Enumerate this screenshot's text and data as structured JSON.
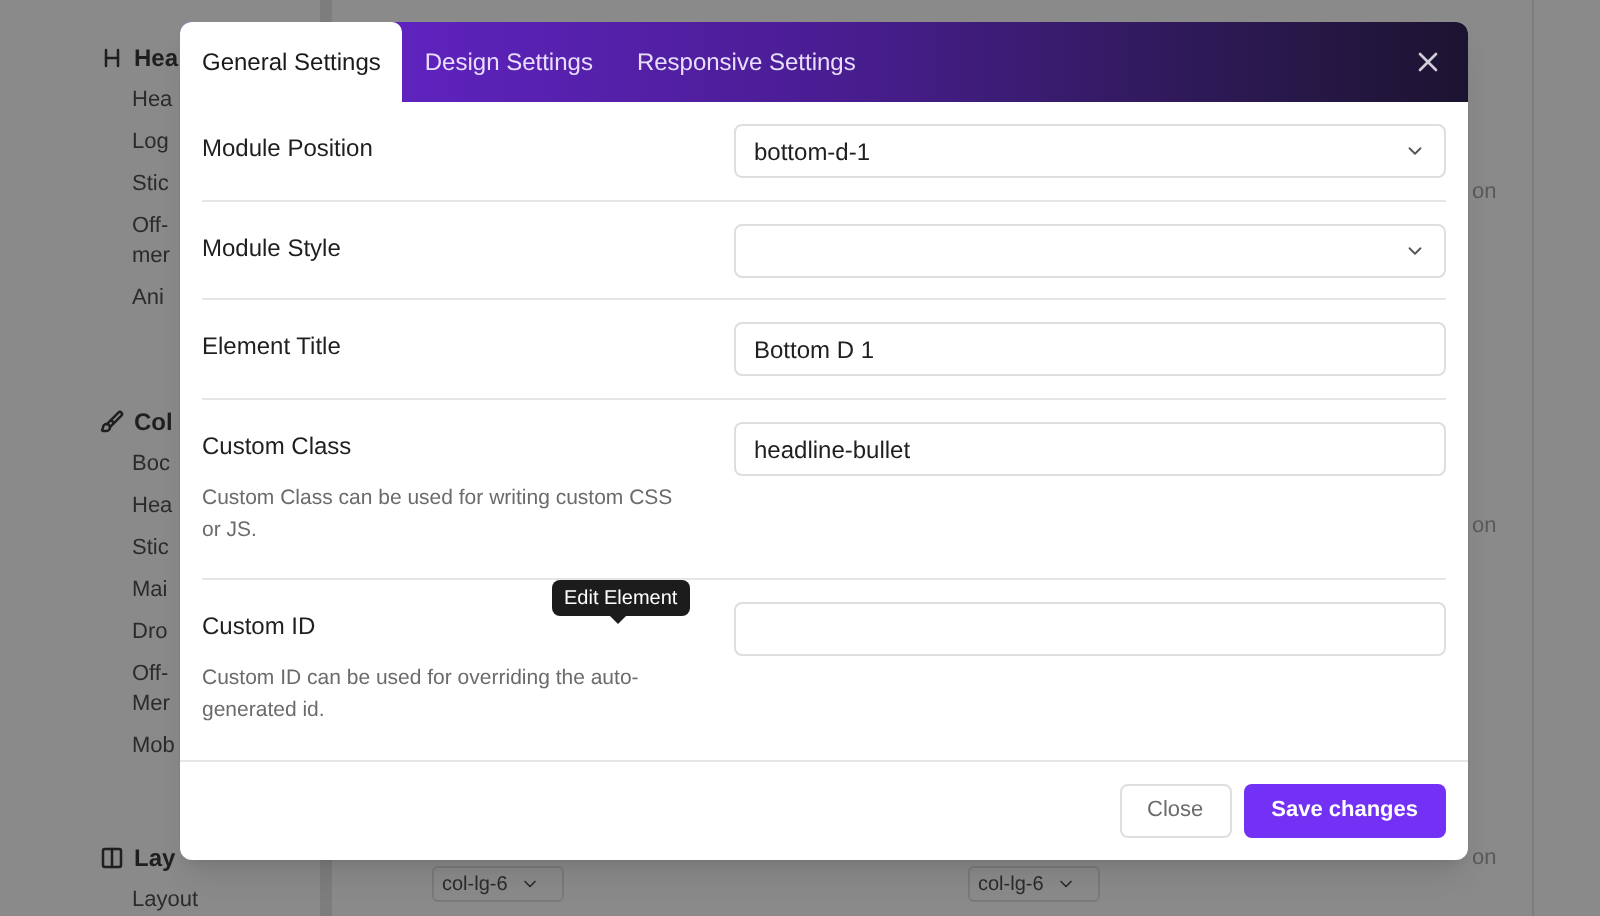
{
  "sidebar": {
    "sections": [
      {
        "kind": "heading",
        "title": "Hea",
        "items": [
          "Hea",
          "Log",
          "Stic",
          "Off-\nmer",
          "Ani"
        ]
      },
      {
        "kind": "brush",
        "title": "Col",
        "items": [
          "Boc",
          "Hea",
          "Stic",
          "Mai",
          "Dro",
          "Off-\nMer",
          "Mob"
        ]
      },
      {
        "kind": "layout",
        "title": "Lay",
        "items": [
          "Layout"
        ]
      }
    ]
  },
  "background": {
    "side_texts": [
      "on",
      "on",
      "on"
    ],
    "selects": [
      "col-lg-6",
      "col-lg-6"
    ]
  },
  "modal": {
    "tabs": [
      {
        "label": "General Settings",
        "selected": true
      },
      {
        "label": "Design Settings",
        "selected": false
      },
      {
        "label": "Responsive Settings",
        "selected": false
      }
    ],
    "fields": [
      {
        "label": "Module Position",
        "kind": "select",
        "value": "bottom-d-1"
      },
      {
        "label": "Module Style",
        "kind": "select"
      },
      {
        "label": "Element Title",
        "kind": "text",
        "value": "Bottom D 1"
      },
      {
        "label": "Custom Class",
        "kind": "text",
        "value": "headline-bullet",
        "help": "Custom Class can be used for writing custom CSS or JS."
      },
      {
        "label": "Custom ID",
        "kind": "text",
        "help": "Custom ID can be used for overriding the auto-generated id."
      }
    ],
    "buttons": [
      {
        "label": "Close",
        "kind": "secondary"
      },
      {
        "label": "Save changes",
        "kind": "primary"
      }
    ]
  },
  "tooltip": "Edit Element"
}
